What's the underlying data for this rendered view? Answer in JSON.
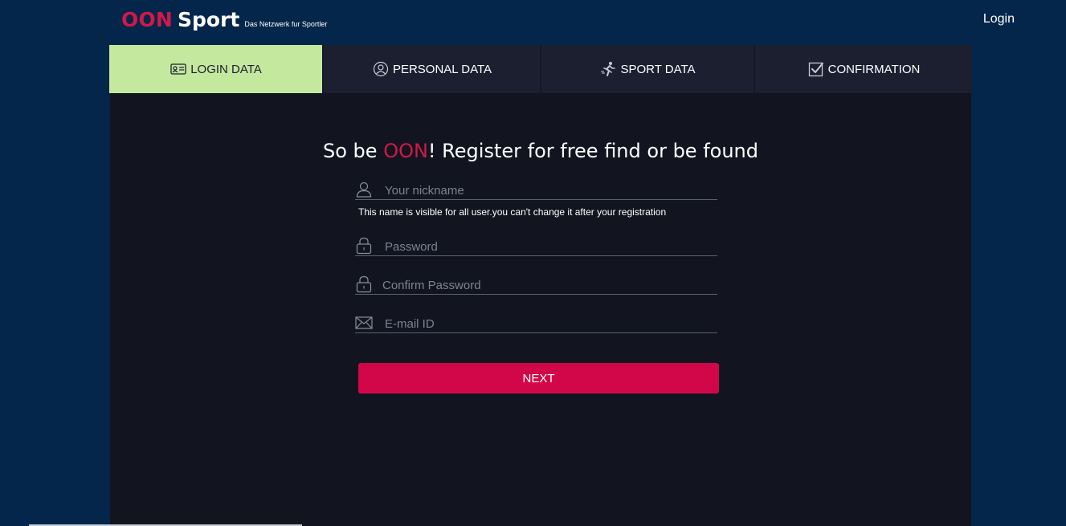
{
  "header": {
    "logo_oon": "OON",
    "logo_sport": "Sport",
    "tagline": "Das Netzwerk fur Sportler",
    "login_label": "Login"
  },
  "tabs": [
    {
      "label": "LOGIN DATA",
      "icon": "id-card-icon",
      "active": true
    },
    {
      "label": "PERSONAL DATA",
      "icon": "user-circle-icon",
      "active": false
    },
    {
      "label": "SPORT DATA",
      "icon": "runner-icon",
      "active": false
    },
    {
      "label": "CONFIRMATION",
      "icon": "checkbox-icon",
      "active": false
    }
  ],
  "form": {
    "heading_prefix": "So be ",
    "heading_brand": "OON",
    "heading_suffix": "! Register for free find or be found",
    "nickname_placeholder": "Your nickname",
    "nickname_hint": "This name is visible for all user.you can't change it after your registration",
    "password_placeholder": "Password",
    "confirm_password_placeholder": "Confirm Password",
    "email_placeholder": "E-mail ID",
    "next_label": "NEXT"
  },
  "colors": {
    "background": "#03264a",
    "brand_red": "#d0184a",
    "active_tab": "#c3e89e",
    "tab_bg": "#1b1f30",
    "panel_bg": "#121520"
  }
}
